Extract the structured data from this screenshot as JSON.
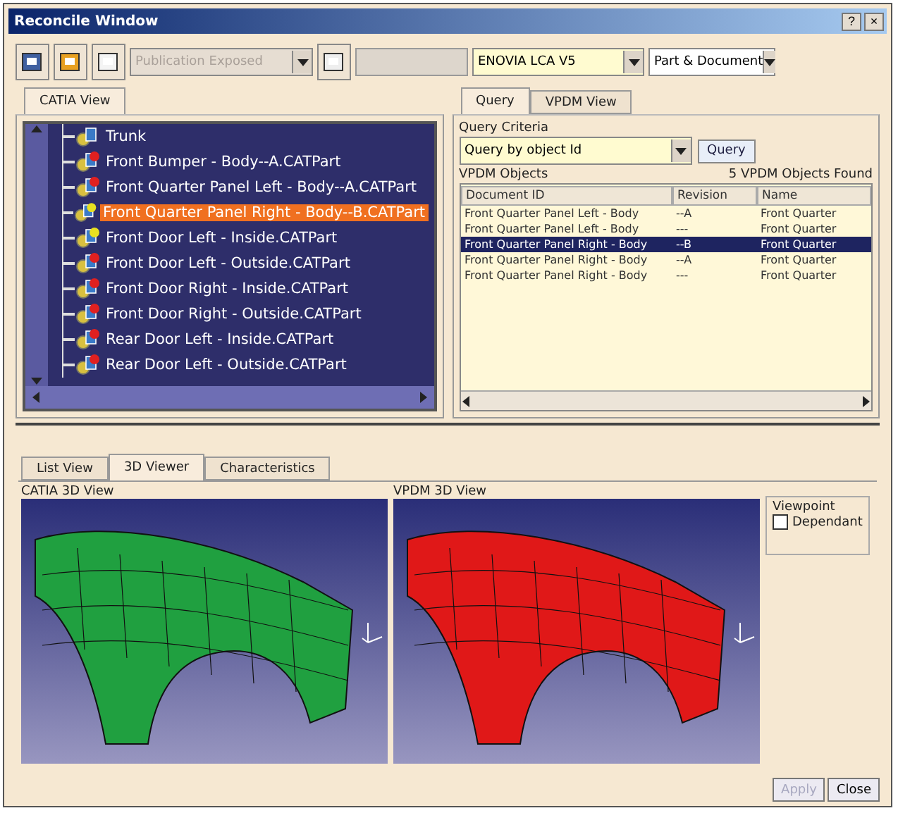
{
  "window": {
    "title": "Reconcile Window",
    "help": "?",
    "close": "×"
  },
  "toolbar": {
    "publication": {
      "value": "Publication Exposed",
      "disabled": true
    },
    "field": {
      "disabled": true
    },
    "server": {
      "value": "ENOVIA LCA V5"
    },
    "scope": {
      "value": "Part & Document"
    }
  },
  "catia_tabs": [
    {
      "label": "CATIA View",
      "selected": true
    }
  ],
  "tree": [
    {
      "label": "Trunk",
      "selected": false
    },
    {
      "label": "Front Bumper - Body--A.CATPart",
      "color": "#e02020",
      "selected": false
    },
    {
      "label": "Front Quarter Panel Left - Body--A.CATPart",
      "color": "#e02020",
      "selected": false
    },
    {
      "label": "Front Quarter Panel Right - Body--B.CATPart",
      "color": "#e8e020",
      "selected": true
    },
    {
      "label": "Front Door Left - Inside.CATPart",
      "color": "#e8e020",
      "selected": false
    },
    {
      "label": "Front Door Left - Outside.CATPart",
      "color": "#e02020",
      "selected": false
    },
    {
      "label": "Front Door Right - Inside.CATPart",
      "color": "#e02020",
      "selected": false
    },
    {
      "label": "Front Door Right - Outside.CATPart",
      "color": "#e02020",
      "selected": false
    },
    {
      "label": "Rear Door Left - Inside.CATPart",
      "color": "#e02020",
      "selected": false
    },
    {
      "label": "Rear Door Left - Outside.CATPart",
      "color": "#e02020",
      "selected": false
    }
  ],
  "query_tabs": [
    {
      "label": "Query",
      "selected": true
    },
    {
      "label": "VPDM View",
      "selected": false
    }
  ],
  "query": {
    "criteria_label": "Query Criteria",
    "criteria": "Query by object Id",
    "button": "Query",
    "objects_label": "VPDM Objects",
    "found": "5  VPDM Objects Found"
  },
  "table": {
    "columns": [
      "Document ID",
      "Revision",
      "Name"
    ],
    "rows": [
      {
        "cells": [
          "Front Quarter Panel Left - Body",
          "--A",
          "Front Quarter"
        ],
        "selected": false
      },
      {
        "cells": [
          "Front Quarter Panel Left - Body",
          "---",
          "Front Quarter"
        ],
        "selected": false
      },
      {
        "cells": [
          "Front Quarter Panel Right - Body",
          "--B",
          "Front Quarter"
        ],
        "selected": true
      },
      {
        "cells": [
          "Front Quarter Panel Right - Body",
          "--A",
          "Front Quarter"
        ],
        "selected": false
      },
      {
        "cells": [
          "Front Quarter Panel Right - Body",
          "---",
          "Front Quarter"
        ],
        "selected": false
      }
    ]
  },
  "bottom_tabs": [
    {
      "label": "List View",
      "selected": false
    },
    {
      "label": "3D Viewer",
      "selected": true
    },
    {
      "label": "Characteristics",
      "selected": false
    }
  ],
  "viewers": [
    {
      "label": "CATIA 3D View",
      "color": "#20a040"
    },
    {
      "label": "VPDM 3D View",
      "color": "#e01818"
    }
  ],
  "viewpoint": {
    "title": "Viewpoint",
    "label": "Dependant",
    "checked": false
  },
  "buttons": [
    {
      "label": "Apply",
      "disabled": true
    },
    {
      "label": "Close",
      "disabled": false
    }
  ]
}
